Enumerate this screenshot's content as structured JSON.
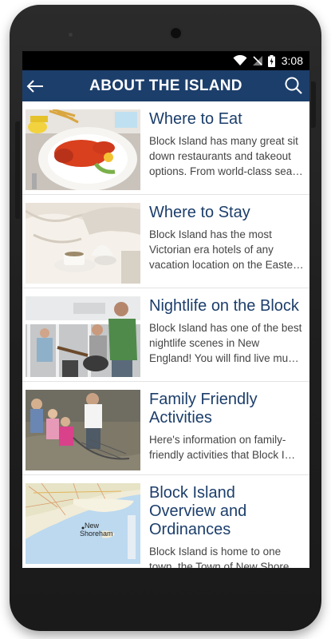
{
  "status_bar": {
    "time": "3:08",
    "icons": [
      "wifi-icon",
      "no-signal-icon",
      "battery-charging-icon"
    ]
  },
  "app_bar": {
    "title": "ABOUT THE ISLAND",
    "back_icon": "back-arrow-icon",
    "search_icon": "search-icon",
    "color": "#1c3e6b"
  },
  "items": [
    {
      "title": "Where to Eat",
      "description": "Block Island has many great sit down restaurants and takeout options. From world-class sea…",
      "image": "lobster-dinner-photo"
    },
    {
      "title": "Where to Stay",
      "description": "Block Island has the most Victorian era hotels of any vacation location on the Easte…",
      "image": "hotel-bed-photo"
    },
    {
      "title": "Nightlife on the Block",
      "description": "Block Island has one of the best nightlife scenes in New England! You will find live mu…",
      "image": "live-band-photo"
    },
    {
      "title": "Family Friendly Activities",
      "description": "Here's information on family-friendly activities that Block I…",
      "image": "kids-fishing-photo"
    },
    {
      "title": "Block Island Overview and Ordinances",
      "description": "Block Island is home to one town, the Town of New Shore…",
      "image": "map-image"
    }
  ],
  "map_labels": {
    "label1": "New",
    "label2": "Shoreham"
  }
}
